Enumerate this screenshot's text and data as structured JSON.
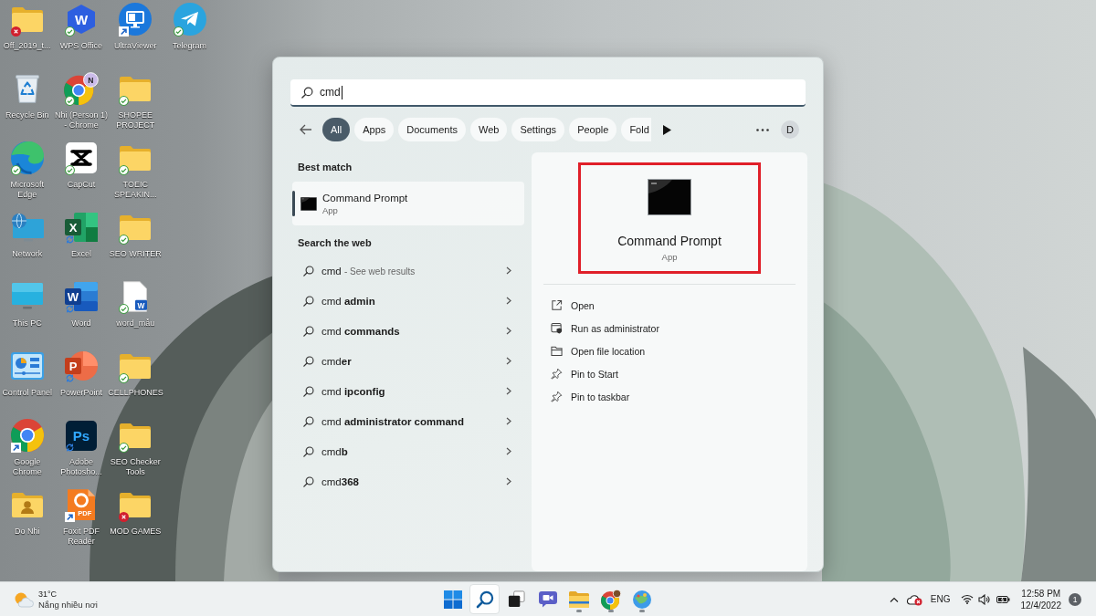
{
  "desktop": {
    "icons": [
      {
        "label": "Off_2019_t...",
        "kind": "folder",
        "badge": {
          "kind": "error"
        }
      },
      {
        "label": "Recycle Bin",
        "kind": "recycle-bin"
      },
      {
        "label": "Microsoft Edge",
        "kind": "edge",
        "badge": {
          "kind": "synced"
        }
      },
      {
        "label": "Network",
        "kind": "network"
      },
      {
        "label": "This PC",
        "kind": "this-pc"
      },
      {
        "label": "Control Panel",
        "kind": "control-panel"
      },
      {
        "label": "Google Chrome",
        "kind": "chrome",
        "badge": {
          "kind": "shortcut"
        }
      },
      {
        "label": "Do Nhi",
        "kind": "user-folder"
      },
      {
        "label": "WPS Office",
        "kind": "wps",
        "glyph": "W",
        "badge": {
          "kind": "synced"
        }
      },
      {
        "label": "Nhi (Person 1) - Chrome",
        "kind": "chrome-profile",
        "glyph": "N",
        "badge": {
          "kind": "synced"
        }
      },
      {
        "label": "CapCut",
        "kind": "capcut",
        "badge": {
          "kind": "synced"
        }
      },
      {
        "label": "Excel",
        "kind": "excel",
        "glyph": "X",
        "badge": {
          "kind": "syncing"
        }
      },
      {
        "label": "Word",
        "kind": "word",
        "glyph": "W",
        "badge": {
          "kind": "syncing"
        }
      },
      {
        "label": "PowerPoint",
        "kind": "powerpoint",
        "glyph": "P",
        "badge": {
          "kind": "syncing"
        }
      },
      {
        "label": "Adobe Photosho...",
        "kind": "photoshop",
        "glyph": "Ps",
        "badge": {
          "kind": "syncing"
        }
      },
      {
        "label": "Foxit PDF Reader",
        "kind": "pdf",
        "glyph": "PDF",
        "badge": {
          "kind": "shortcut"
        }
      },
      {
        "label": "UltraViewer",
        "kind": "remote-monitor",
        "badge": {
          "kind": "shortcut"
        }
      },
      {
        "label": "SHOPEE PROJECT",
        "kind": "folder",
        "badge": {
          "kind": "synced"
        }
      },
      {
        "label": "TOEIC SPEAKIN...",
        "kind": "folder",
        "badge": {
          "kind": "synced"
        }
      },
      {
        "label": "SEO WRITER",
        "kind": "folder",
        "badge": {
          "kind": "synced"
        }
      },
      {
        "label": "word_mẫu",
        "kind": "word-doc",
        "glyph": "W",
        "badge": {
          "kind": "synced"
        }
      },
      {
        "label": "CELLPHONES",
        "kind": "folder",
        "badge": {
          "kind": "synced"
        }
      },
      {
        "label": "SEO Checker Tools",
        "kind": "folder",
        "badge": {
          "kind": "synced"
        }
      },
      {
        "label": "MOD GAMES",
        "kind": "folder",
        "badge": {
          "kind": "error"
        }
      },
      {
        "label": "Telegram",
        "kind": "telegram",
        "badge": {
          "kind": "synced"
        }
      }
    ]
  },
  "search": {
    "query": "cmd",
    "filters": [
      {
        "label": "All",
        "selected": true
      },
      {
        "label": "Apps",
        "selected": false
      },
      {
        "label": "Documents",
        "selected": false
      },
      {
        "label": "Web",
        "selected": false
      },
      {
        "label": "Settings",
        "selected": false
      },
      {
        "label": "People",
        "selected": false
      },
      {
        "label": "Fold",
        "selected": false
      }
    ],
    "account_initial": "D"
  },
  "results": {
    "best_match_heading": "Best match",
    "best_match": {
      "title": "Command Prompt",
      "subtitle": "App",
      "selected": true
    },
    "web_heading": "Search the web",
    "web_items": [
      {
        "text": "cmd",
        "hint": "- See web results",
        "selected": false
      },
      {
        "text": "cmd **admin**",
        "selected": false
      },
      {
        "text": "cmd **commands**",
        "selected": false
      },
      {
        "text": "cmd**er**",
        "selected": false
      },
      {
        "text": "cmd **ipconfig**",
        "selected": false
      },
      {
        "text": "cmd **administrator command**",
        "selected": false
      },
      {
        "text": "cmd**b**",
        "selected": false
      },
      {
        "text": "cmd**368**",
        "selected": false
      }
    ]
  },
  "preview": {
    "title": "Command Prompt",
    "subtitle": "App",
    "highlighted": true,
    "actions": [
      {
        "label": "Open",
        "kind": "open"
      },
      {
        "label": "Run as administrator",
        "kind": "run-as-admin"
      },
      {
        "label": "Open file location",
        "kind": "file-location"
      },
      {
        "label": "Pin to Start",
        "kind": "pin"
      },
      {
        "label": "Pin to taskbar",
        "kind": "pin"
      }
    ]
  },
  "taskbar": {
    "weather": {
      "temperature": "31°C",
      "condition": "Nắng nhiều nơi"
    },
    "apps": [
      {
        "kind": "start",
        "selected": false,
        "running": false
      },
      {
        "kind": "search",
        "selected": true,
        "running": false
      },
      {
        "kind": "task-view",
        "selected": false,
        "running": false
      },
      {
        "kind": "chat",
        "selected": false,
        "running": false
      },
      {
        "kind": "file-explorer",
        "selected": false,
        "running": true
      },
      {
        "kind": "chrome",
        "selected": false,
        "running": true
      },
      {
        "kind": "globe",
        "selected": false,
        "running": true
      }
    ],
    "tray": {
      "language": "ENG",
      "time": "12:58 PM",
      "date": "12/4/2022",
      "notifications": "1"
    }
  }
}
